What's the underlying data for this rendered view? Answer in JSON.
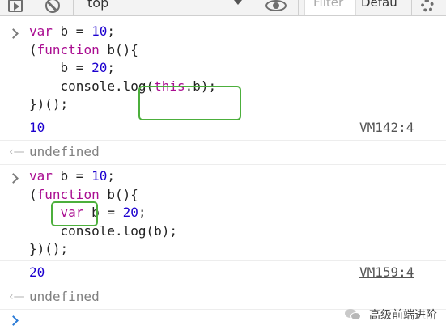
{
  "toolbar": {
    "context_selected": "top",
    "filter_placeholder": "Filter",
    "level_label": "Defau"
  },
  "entries": [
    {
      "input_lines": [
        [
          {
            "t": "var",
            "c": "kw"
          },
          {
            "t": " b = ",
            "c": ""
          },
          {
            "t": "10",
            "c": "num"
          },
          {
            "t": ";",
            "c": ""
          }
        ],
        [
          {
            "t": "(",
            "c": ""
          },
          {
            "t": "function",
            "c": "kw"
          },
          {
            "t": " b(){",
            "c": ""
          }
        ],
        [
          {
            "t": "    b = ",
            "c": ""
          },
          {
            "t": "20",
            "c": "num"
          },
          {
            "t": ";",
            "c": ""
          }
        ],
        [
          {
            "t": "    console.log(",
            "c": ""
          },
          {
            "t": "this",
            "c": "kw"
          },
          {
            "t": ".b);",
            "c": ""
          }
        ],
        [
          {
            "t": "})();",
            "c": ""
          }
        ]
      ],
      "output": "10",
      "source": "VM142:4",
      "return_value": "undefined"
    },
    {
      "input_lines": [
        [
          {
            "t": "var",
            "c": "kw"
          },
          {
            "t": " b = ",
            "c": ""
          },
          {
            "t": "10",
            "c": "num"
          },
          {
            "t": ";",
            "c": ""
          }
        ],
        [
          {
            "t": "(",
            "c": ""
          },
          {
            "t": "function",
            "c": "kw"
          },
          {
            "t": " b(){",
            "c": ""
          }
        ],
        [
          {
            "t": "    ",
            "c": ""
          },
          {
            "t": "var",
            "c": "kw"
          },
          {
            "t": " b = ",
            "c": ""
          },
          {
            "t": "20",
            "c": "num"
          },
          {
            "t": ";",
            "c": ""
          }
        ],
        [
          {
            "t": "    console.log(b);",
            "c": ""
          }
        ],
        [
          {
            "t": "})();",
            "c": ""
          }
        ]
      ],
      "output": "20",
      "source": "VM159:4",
      "return_value": "undefined"
    }
  ],
  "watermark": "高级前端进阶",
  "colors": {
    "keyword": "#aa0d91",
    "number": "#1c00cf",
    "highlight_box": "#4caf3c",
    "prompt_active": "#2b7bd7"
  }
}
